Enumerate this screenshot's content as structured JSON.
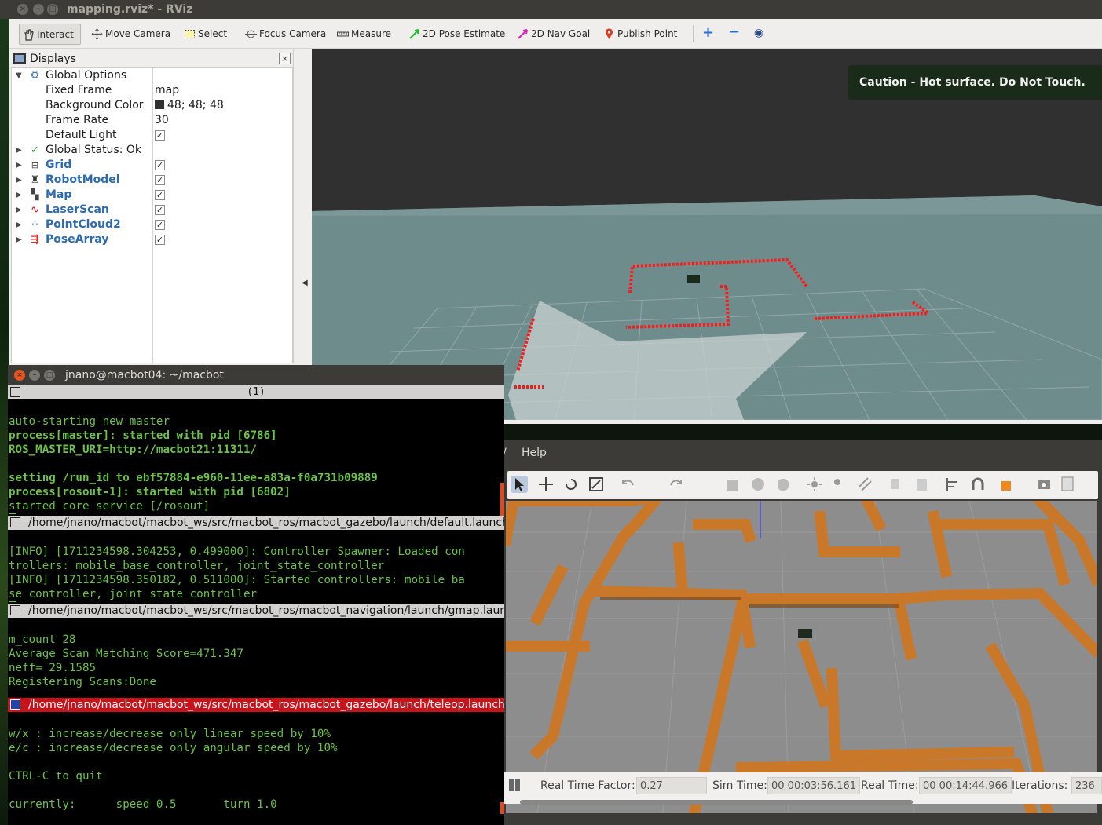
{
  "rviz": {
    "title": "mapping.rviz* - RViz",
    "toolbar": {
      "interact": "Interact",
      "move_camera": "Move Camera",
      "select": "Select",
      "focus_camera": "Focus Camera",
      "measure": "Measure",
      "pose_estimate": "2D Pose Estimate",
      "nav_goal": "2D Nav Goal",
      "publish_point": "Publish Point"
    },
    "displays": {
      "title": "Displays",
      "global_options": "Global Options",
      "fixed_frame_label": "Fixed Frame",
      "fixed_frame_value": "map",
      "bg_color_label": "Background Color",
      "bg_color_value": "48; 48; 48",
      "frame_rate_label": "Frame Rate",
      "frame_rate_value": "30",
      "default_light_label": "Default Light",
      "global_status": "Global Status: Ok",
      "items": [
        {
          "label": "Grid",
          "checked": true
        },
        {
          "label": "RobotModel",
          "checked": true
        },
        {
          "label": "Map",
          "checked": true
        },
        {
          "label": "LaserScan",
          "checked": true
        },
        {
          "label": "PointCloud2",
          "checked": true
        },
        {
          "label": "PoseArray",
          "checked": true
        }
      ]
    },
    "caution": "Caution - Hot surface. Do Not Touch.",
    "colors": {
      "background": "#303030",
      "grid_floor": "#6f8c8c",
      "laser": "#ff0000"
    }
  },
  "gazebo": {
    "menu_partial": "/",
    "menu_help": "Help",
    "status": {
      "rtf_label": "Real Time Factor:",
      "rtf_value": "0.27",
      "sim_label": "Sim Time:",
      "sim_value": "00 00:03:56.161",
      "real_label": "Real Time:",
      "real_value": "00 00:14:44.966",
      "iter_label": "Iterations:",
      "iter_value": "236"
    }
  },
  "terminal": {
    "title": "jnano@macbot04: ~/macbot",
    "tab": "(1)",
    "pane1": [
      "auto-starting new master",
      "process[master]: started with pid [6786]",
      "ROS_MASTER_URI=http://macbot21:11311/",
      "",
      "setting /run_id to ebf57884-e960-11ee-a83a-f0a731b09889",
      "process[rosout-1]: started with pid [6802]",
      "started core service [/rosout]"
    ],
    "pane2_header": "/home/jnano/macbot/macbot_ws/src/macbot_ros/macbot_gazebo/launch/default.launch",
    "pane2": [
      "[INFO] [1711234598.304253, 0.499000]: Controller Spawner: Loaded con",
      "trollers: mobile_base_controller, joint_state_controller",
      "[INFO] [1711234598.350182, 0.511000]: Started controllers: mobile_ba",
      "se_controller, joint_state_controller"
    ],
    "pane3_header": "/home/jnano/macbot/macbot_ws/src/macbot_ros/macbot_navigation/launch/gmap.launch",
    "pane3": [
      "m_count 28",
      "Average Scan Matching Score=471.347",
      "neff= 29.1585",
      "Registering Scans:Done"
    ],
    "pane4_header": "/home/jnano/macbot/macbot_ws/src/macbot_ros/macbot_gazebo/launch/teleop.launch",
    "pane4": [
      "w/x : increase/decrease only linear speed by 10%",
      "e/c : increase/decrease only angular speed by 10%",
      "",
      "CTRL-C to quit",
      "",
      "currently:      speed 0.5       turn 1.0"
    ]
  }
}
